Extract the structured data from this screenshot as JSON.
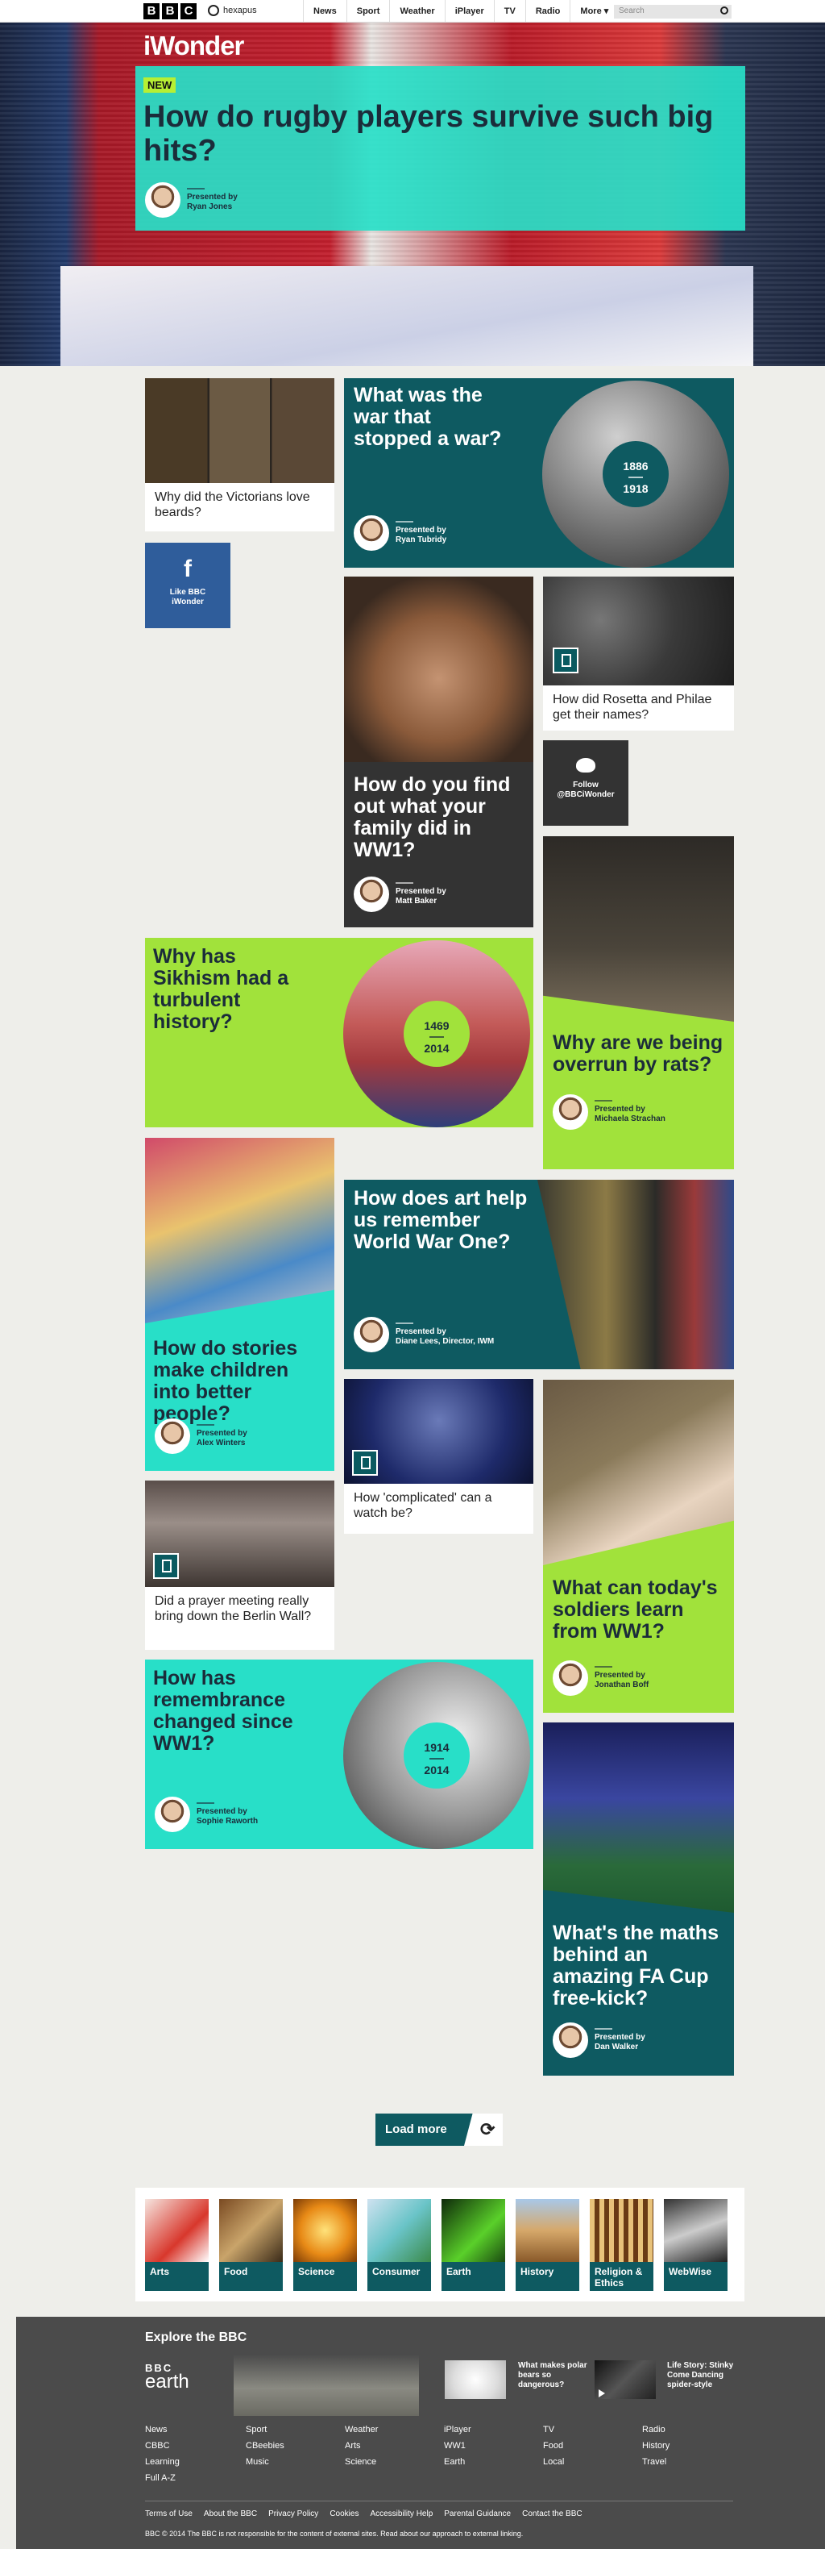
{
  "nav": {
    "logo": [
      "B",
      "B",
      "C"
    ],
    "user": "hexapus",
    "links": [
      "News",
      "Sport",
      "Weather",
      "iPlayer",
      "TV",
      "Radio",
      "More"
    ],
    "more_arrow": "▾",
    "search_placeholder": "Search"
  },
  "hero": {
    "brand": "iWonder",
    "badge": "NEW",
    "title": "How do rugby players survive such big hits?",
    "presented_by": "Presented by",
    "presenter": "Ryan Jones"
  },
  "cards": {
    "beards": {
      "caption": "Why did the Victorians love beards?"
    },
    "war": {
      "title": "What was the war that stopped a war?",
      "date_start": "1886",
      "date_end": "1918",
      "presented_by": "Presented by",
      "presenter": "Ryan Tubridy"
    },
    "facebook": {
      "label": "Like BBC iWonder",
      "icon": "f"
    },
    "rosetta": {
      "caption": "How did Rosetta and Philae get their names?"
    },
    "family": {
      "title": "How do you find out what your family did in WW1?",
      "presented_by": "Presented by",
      "presenter": "Matt Baker"
    },
    "twitter": {
      "label": "Follow @BBCiWonder"
    },
    "sikhism": {
      "title": "Why has Sikhism had a turbulent history?",
      "date_start": "1469",
      "date_end": "2014"
    },
    "rats": {
      "title": "Why are we being overrun by rats?",
      "presented_by": "Presented by",
      "presenter": "Michaela Strachan"
    },
    "stories": {
      "title": "How do stories make children into better people?",
      "presented_by": "Presented by",
      "presenter": "Alex Winters"
    },
    "art": {
      "title": "How does art help us remember World War One?",
      "presented_by": "Presented by",
      "presenter": "Diane Lees, Director, IWM"
    },
    "watch": {
      "caption": "How 'complicated' can a watch be?"
    },
    "soldiers": {
      "title": "What can today's soldiers learn from WW1?",
      "presented_by": "Presented by",
      "presenter": "Jonathan Boff"
    },
    "berlin": {
      "caption": "Did a prayer meeting really bring down the Berlin Wall?"
    },
    "remembrance": {
      "title": "How has remembrance changed since WW1?",
      "date_start": "1914",
      "date_end": "2014",
      "presented_by": "Presented by",
      "presenter": "Sophie Raworth"
    },
    "freekick": {
      "title": "What's the maths behind an amazing FA Cup free-kick?",
      "presented_by": "Presented by",
      "presenter": "Dan Walker"
    }
  },
  "load_more": "Load more",
  "categories": [
    "Arts",
    "Food",
    "Science",
    "Consumer",
    "Earth",
    "History",
    "Religion & Ethics",
    "WebWise"
  ],
  "footer": {
    "heading": "Explore the BBC",
    "earth_logo_top": "BBC",
    "earth_logo_bottom": "earth",
    "promo1": "What makes polar bears so dangerous?",
    "promo2": "Life Story: Stinky Come Dancing spider-style",
    "columns": [
      [
        "News",
        "CBBC",
        "Learning",
        "Full A-Z"
      ],
      [
        "Sport",
        "CBeebies",
        "Music"
      ],
      [
        "Weather",
        "Arts",
        "Science"
      ],
      [
        "iPlayer",
        "WW1",
        "Earth"
      ],
      [
        "TV",
        "Food",
        "Local"
      ],
      [
        "Radio",
        "History",
        "Travel"
      ]
    ],
    "bottom_links": [
      "Terms of Use",
      "About the BBC",
      "Privacy Policy",
      "Cookies",
      "Accessibility Help",
      "Parental Guidance",
      "Contact the BBC"
    ],
    "copyright": "BBC © 2014 The BBC is not responsible for the content of external sites. Read about our approach to external linking."
  }
}
